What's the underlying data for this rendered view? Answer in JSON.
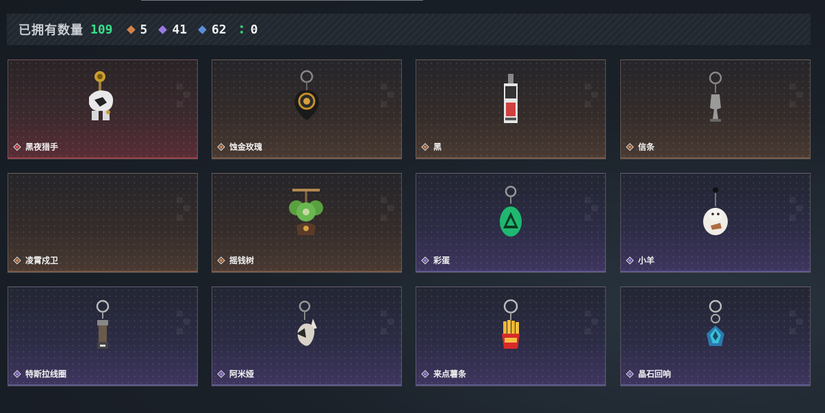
{
  "summary": {
    "owned_label": "已拥有数量",
    "owned_count": "109",
    "stats": [
      {
        "icon": "orange-diamond-icon",
        "color": "#d4824a",
        "value": "5"
      },
      {
        "icon": "purple-diamond-icon",
        "color": "#9a7ae0",
        "value": "41"
      },
      {
        "icon": "blue-diamond-icon",
        "color": "#5a8fd8",
        "value": "62"
      },
      {
        "icon": "green-dots-icon",
        "color": "#39c87a",
        "value": "0"
      }
    ]
  },
  "items": [
    {
      "name": "黑夜猎手",
      "rarity": "red",
      "icon": "night-hunter-charm-icon"
    },
    {
      "name": "蚀金玫瑰",
      "rarity": "orange",
      "icon": "gilded-rose-charm-icon"
    },
    {
      "name": "黑",
      "rarity": "orange",
      "icon": "black-tag-charm-icon"
    },
    {
      "name": "信条",
      "rarity": "orange",
      "icon": "creed-charm-icon"
    },
    {
      "name": "凌霄戍卫",
      "rarity": "orange",
      "icon": "empty-slot"
    },
    {
      "name": "摇钱树",
      "rarity": "orange",
      "icon": "money-tree-charm-icon"
    },
    {
      "name": "彩蛋",
      "rarity": "purple",
      "icon": "easter-egg-charm-icon"
    },
    {
      "name": "小羊",
      "rarity": "purple",
      "icon": "lamb-charm-icon"
    },
    {
      "name": "特斯拉线圈",
      "rarity": "purple",
      "icon": "tesla-coil-charm-icon"
    },
    {
      "name": "阿米娅",
      "rarity": "purple",
      "icon": "amiya-charm-icon"
    },
    {
      "name": "来点薯条",
      "rarity": "purple",
      "icon": "fries-charm-icon"
    },
    {
      "name": "晶石回响",
      "rarity": "purple",
      "icon": "crystal-echo-charm-icon"
    }
  ]
}
